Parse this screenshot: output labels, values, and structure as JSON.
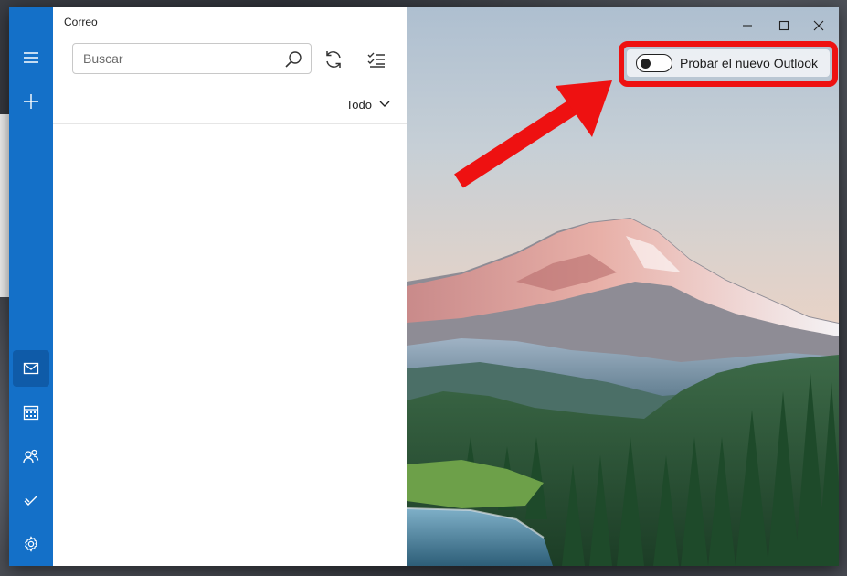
{
  "app": {
    "title": "Correo"
  },
  "window_controls": {
    "minimize_icon": "minimize-icon",
    "maximize_icon": "maximize-icon",
    "close_icon": "close-icon"
  },
  "nav_rail": {
    "items": [
      {
        "name": "menu",
        "icon": "hamburger-icon"
      },
      {
        "name": "new-mail",
        "icon": "plus-icon"
      },
      {
        "name": "mail",
        "icon": "mail-icon",
        "active": true
      },
      {
        "name": "calendar",
        "icon": "calendar-icon"
      },
      {
        "name": "people",
        "icon": "people-icon"
      },
      {
        "name": "todo",
        "icon": "checkmark-icon"
      },
      {
        "name": "settings",
        "icon": "gear-icon"
      }
    ],
    "accent_color": "#1470c8"
  },
  "search": {
    "placeholder": "Buscar",
    "value": ""
  },
  "toolbar": {
    "sync_icon": "sync-icon",
    "select_icon": "select-list-icon"
  },
  "filter": {
    "label": "Todo"
  },
  "new_outlook": {
    "label": "Probar el nuevo Outlook",
    "enabled": false,
    "highlight_color": "#ee1111"
  }
}
